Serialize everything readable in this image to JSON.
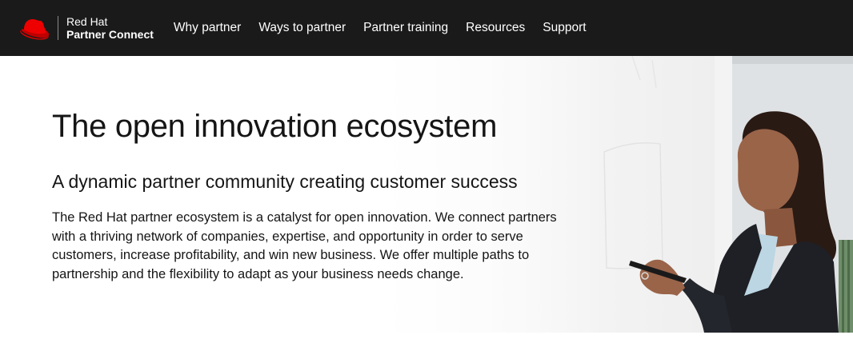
{
  "brand": {
    "line1": "Red Hat",
    "line2": "Partner Connect",
    "logo_icon": "red-hat-logo-icon",
    "accent_color": "#ee0000"
  },
  "nav": {
    "items": [
      {
        "label": "Why partner"
      },
      {
        "label": "Ways to partner"
      },
      {
        "label": "Partner training"
      },
      {
        "label": "Resources"
      },
      {
        "label": "Support"
      }
    ]
  },
  "hero": {
    "title": "The open innovation ecosystem",
    "subtitle": "A dynamic partner community creating customer success",
    "body": "The Red Hat partner ecosystem is a catalyst for open innovation. We connect partners with a thriving network of companies, expertise, and opportunity in order to serve customers, increase profitability, and win new business. We offer multiple paths to partnership and the flexibility to adapt as your business needs change."
  },
  "colors": {
    "navbar_bg": "#1a1a1a",
    "text": "#151515"
  }
}
